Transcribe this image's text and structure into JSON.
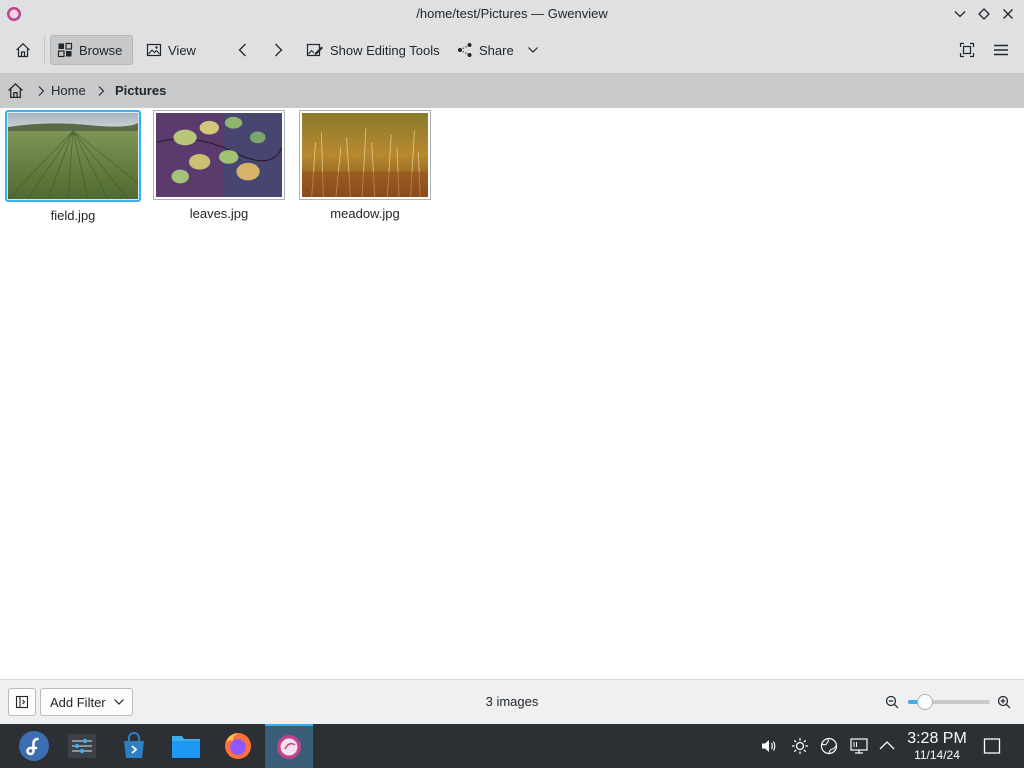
{
  "window": {
    "title": "/home/test/Pictures — Gwenview",
    "controls": [
      "chevron-down-icon",
      "diamond-icon",
      "close-icon"
    ]
  },
  "toolbar": {
    "browse_label": "Browse",
    "view_label": "View",
    "editing_label": "Show Editing Tools",
    "share_label": "Share"
  },
  "breadcrumb": {
    "items": [
      "Home",
      "Pictures"
    ]
  },
  "thumbnails": [
    {
      "name": "field.jpg",
      "selected": true
    },
    {
      "name": "leaves.jpg",
      "selected": false
    },
    {
      "name": "meadow.jpg",
      "selected": false
    }
  ],
  "statusbar": {
    "filter_label": "Add Filter",
    "count_label": "3 images",
    "zoom_level": 0.14
  },
  "taskbar": {
    "apps": [
      "fedora-launcher-icon",
      "system-settings-icon",
      "discover-store-icon",
      "file-manager-icon",
      "firefox-icon",
      "gwenview-icon"
    ],
    "time": "3:28 PM",
    "date": "11/14/24"
  },
  "colors": {
    "accent": "#3daee9",
    "titlebar": "#dee0e2",
    "taskbar": "#2c3035"
  }
}
